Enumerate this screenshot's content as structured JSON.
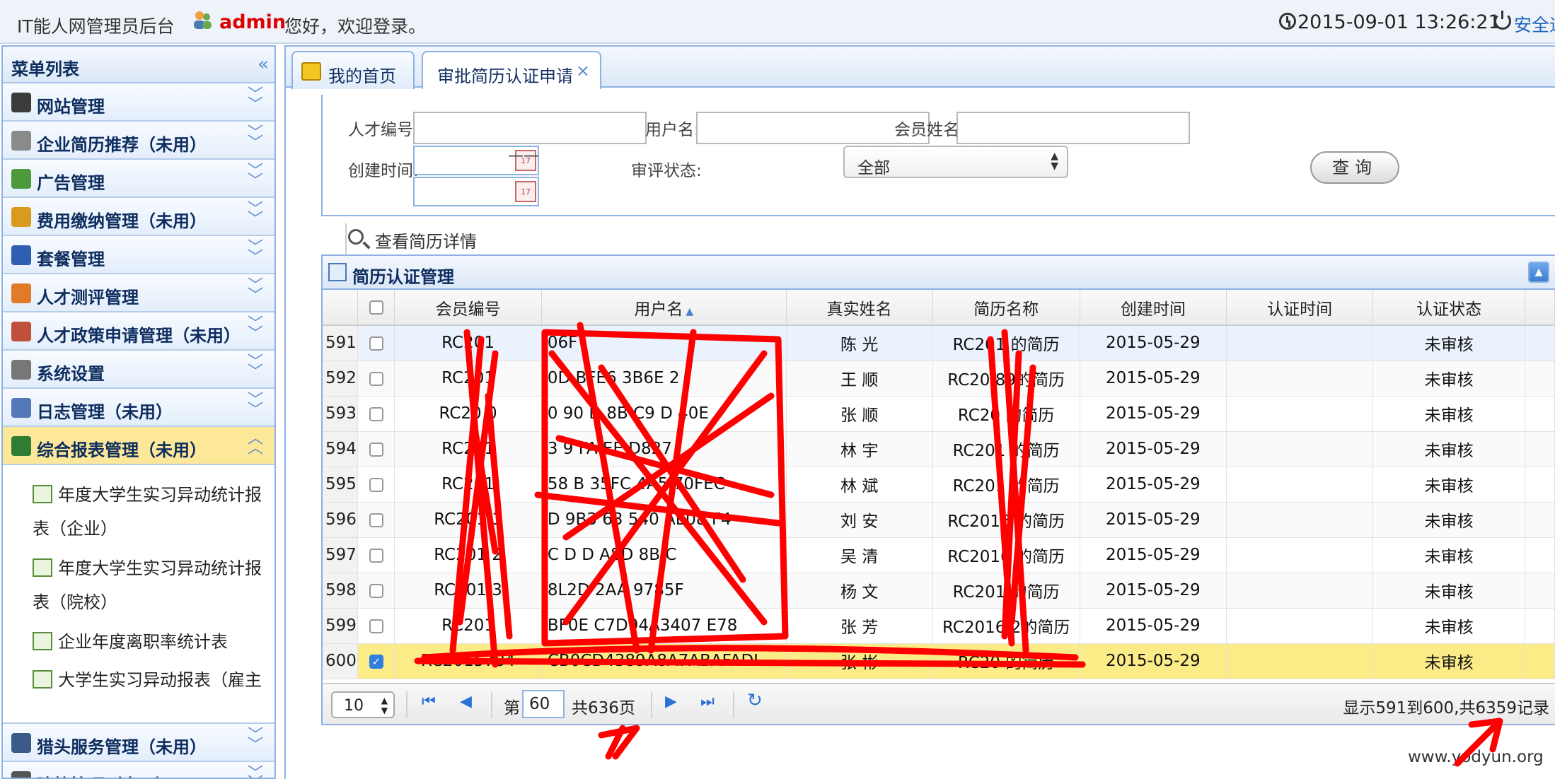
{
  "header": {
    "system_title": "IT能人网管理员后台",
    "admin_name": "admin",
    "welcome": "您好，欢迎登录。",
    "datetime": "2015-09-01 13:26:21",
    "logout": "安全退"
  },
  "sidebar": {
    "title": "菜单列表",
    "items": [
      {
        "label": "网站管理",
        "icon": "agent-icon",
        "color": "#3b3b3b"
      },
      {
        "label": "企业简历推荐（未用）",
        "icon": "document-list-icon",
        "color": "#8a8a8a"
      },
      {
        "label": "广告管理",
        "icon": "billboard-icon",
        "color": "#4c9a3a"
      },
      {
        "label": "费用缴纳管理（未用）",
        "icon": "crown-icon",
        "color": "#d99a20"
      },
      {
        "label": "套餐管理",
        "icon": "books-icon",
        "color": "#2f5fb0"
      },
      {
        "label": "人才测评管理",
        "icon": "pencil-note-icon",
        "color": "#e07b2a"
      },
      {
        "label": "人才政策申请管理（未用）",
        "icon": "person-icon",
        "color": "#c0503a"
      },
      {
        "label": "系统设置",
        "icon": "server-icon",
        "color": "#777777"
      },
      {
        "label": "日志管理（未用）",
        "icon": "log-document-icon",
        "color": "#5579b8"
      },
      {
        "label": "综合报表管理（未用）",
        "icon": "excel-icon",
        "color": "#2e7d32"
      }
    ],
    "submenu": [
      {
        "line1": "年度大学生实习异动统计报",
        "line2": "表（企业）"
      },
      {
        "line1": "年度大学生实习异动统计报",
        "line2": "表（院校）"
      },
      {
        "line1": "企业年度离职率统计表",
        "line2": ""
      },
      {
        "line1": "大学生实习异动报表（雇主",
        "line2": ""
      }
    ],
    "bottom_items": [
      {
        "label": "猎头服务管理（未用）",
        "icon": "headhunter-icon",
        "color": "#3a5a8a"
      },
      {
        "label": "院校管理（未用）",
        "icon": "eye-icon",
        "color": "#555555"
      }
    ]
  },
  "tabs": {
    "home": "我的首页",
    "current": "审批简历认证申请",
    "close": "×"
  },
  "filters": {
    "talent_no_label": "人才编号:",
    "username_label": "用户名:",
    "member_name_label": "会员姓名:",
    "created_label": "创建时间:",
    "date_sep": "——",
    "status_label": "审评状态:",
    "status_value": "全部",
    "query_button": "查询",
    "cal_text": "17"
  },
  "toolbar": {
    "view_detail": "查看简历详情"
  },
  "grid": {
    "title": "简历认证管理",
    "columns": [
      "会员编号",
      "用户名",
      "真实姓名",
      "简历名称",
      "创建时间",
      "认证时间",
      "认证状态"
    ],
    "rows": [
      {
        "n": "591",
        "member_no": "RC201",
        "username": "06F",
        "real_name": "陈 光",
        "resume": "RC201 的简历",
        "created": "2015-05-29",
        "cert_time": "",
        "status": "未审核"
      },
      {
        "n": "592",
        "member_no": "RC201",
        "username": "0D BFE6 3B6E 2",
        "real_name": "王 顺",
        "resume": "RC20 89的简历",
        "created": "2015-05-29",
        "cert_time": "",
        "status": "未审核"
      },
      {
        "n": "593",
        "member_no": "RC20 0",
        "username": "0 90 D 8B C9 D 40E",
        "real_name": "张 顺",
        "resume": "RC20 的简历",
        "created": "2015-05-29",
        "cert_time": "",
        "status": "未审核"
      },
      {
        "n": "594",
        "member_no": "RC201",
        "username": "3 9 FA EE D827",
        "real_name": "林 宇",
        "resume": "RC201 的简历",
        "created": "2015-05-29",
        "cert_time": "",
        "status": "未审核"
      },
      {
        "n": "595",
        "member_no": "RC201",
        "username": "58 B 35FC 4A5 70FEC",
        "real_name": "林 斌",
        "resume": "RC201 的简历",
        "created": "2015-05-29",
        "cert_time": "",
        "status": "未审核"
      },
      {
        "n": "596",
        "member_no": "RC201 1",
        "username": "D 9B3 63 540 AE08 F4",
        "real_name": "刘 安",
        "resume": "RC2016 的简历",
        "created": "2015-05-29",
        "cert_time": "",
        "status": "未审核"
      },
      {
        "n": "597",
        "member_no": "RC201 2",
        "username": "C D D A8D 8B C",
        "real_name": "吴 清",
        "resume": "RC2016 的简历",
        "created": "2015-05-29",
        "cert_time": "",
        "status": "未审核"
      },
      {
        "n": "598",
        "member_no": "RC201 3",
        "username": "8L2D 2AA 9785F",
        "real_name": "杨 文",
        "resume": "RC201 的简历",
        "created": "2015-05-29",
        "cert_time": "",
        "status": "未审核"
      },
      {
        "n": "599",
        "member_no": "RC201",
        "username": "BF0E C7D94A3407 E78",
        "real_name": "张 芳",
        "resume": "RC2016 2的简历",
        "created": "2015-05-29",
        "cert_time": "",
        "status": "未审核"
      },
      {
        "n": "600",
        "member_no": "RC2015784",
        "username": "CB0CD4389A8A7ABAFADI",
        "real_name": "张 彬",
        "resume": "RC20 的简历",
        "created": "2015-05-29",
        "cert_time": "",
        "status": "未审核"
      }
    ]
  },
  "pager": {
    "page_size": "10",
    "page_prefix": "第",
    "page_value": "60",
    "page_total": "共636页",
    "info": "显示591到600,共6359记录"
  },
  "watermark": "www.yodyun.org",
  "colors": {
    "accent": "#8db2e3",
    "selected_row": "#fbec88",
    "active_menu": "#fce898",
    "scribble": "#ff0000",
    "admin_name": "#dd0000"
  }
}
